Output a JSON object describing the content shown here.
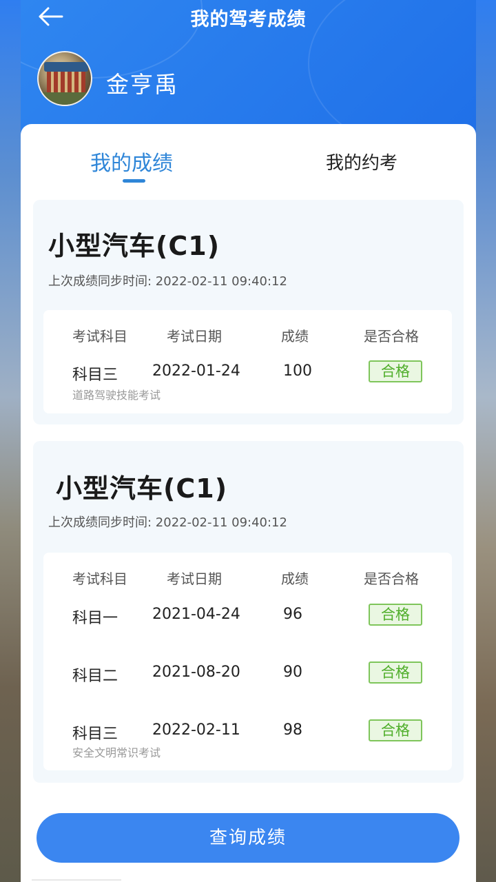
{
  "header": {
    "title": "我的驾考成绩",
    "username": "金亨禹",
    "back_icon": "arrow-left-icon"
  },
  "tabs": [
    {
      "label": "我的成绩",
      "active": true
    },
    {
      "label": "我的约考",
      "active": false
    }
  ],
  "cards": [
    {
      "title": "小型汽车(C1)",
      "sync_time": "上次成绩同步时间: 2022-02-11 09:40:12",
      "columns": [
        "考试科目",
        "考试日期",
        "成绩",
        "是否合格"
      ],
      "rows": [
        {
          "subject": "科目三",
          "date": "2022-01-24",
          "score": "100",
          "result": "合格",
          "note": "道路驾驶技能考试"
        }
      ]
    },
    {
      "title": "小型汽车(C1)",
      "sync_time": "上次成绩同步时间: 2022-02-11 09:40:12",
      "columns": [
        "考试科目",
        "考试日期",
        "成绩",
        "是否合格"
      ],
      "rows": [
        {
          "subject": "科目一",
          "date": "2021-04-24",
          "score": "96",
          "result": "合格"
        },
        {
          "subject": "科目二",
          "date": "2021-08-20",
          "score": "90",
          "result": "合格"
        },
        {
          "subject": "科目三",
          "date": "2022-02-11",
          "score": "98",
          "result": "合格",
          "note": "安全文明常识考试"
        }
      ]
    }
  ],
  "query_button": "查询成绩",
  "colors": {
    "header_blue": "#2f86f0",
    "tab_active": "#2f86d8",
    "pass_green": "#4fae2a",
    "button_blue": "#3b86f0"
  }
}
